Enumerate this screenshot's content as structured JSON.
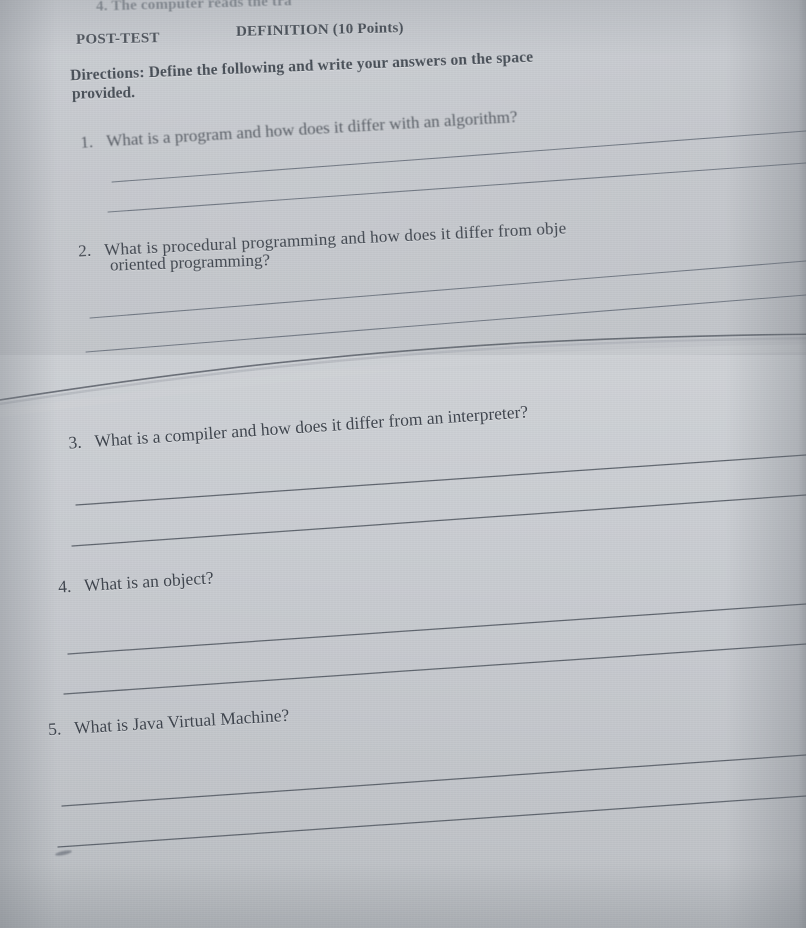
{
  "document": {
    "kind": "photographed-worksheet",
    "cut_off_top_line": "4. The computer reads the tra",
    "section_label": "POST-TEST",
    "section_type": "DEFINITION (10 Points)",
    "directions_label": "Directions:",
    "directions_line_1": "Directions: Define the following and write your answers on the space",
    "directions_line_2": "provided.",
    "questions": [
      {
        "number": "1.",
        "text": "What is a program and how does it differ with an algorithm?",
        "answer_lines": 2,
        "answer_line_values": [
          "",
          ""
        ]
      },
      {
        "number": "2.",
        "text_line_1": "What is procedural programming and how does it differ from obje",
        "text_line_2": "oriented programming?",
        "answer_lines": 2,
        "answer_line_values": [
          "",
          ""
        ]
      },
      {
        "number": "3.",
        "text": "What is a compiler and how does it differ from an interpreter?",
        "answer_lines": 2,
        "answer_line_values": [
          "",
          ""
        ]
      },
      {
        "number": "4.",
        "text": "What is an object?",
        "answer_lines": 2,
        "answer_line_values": [
          "",
          ""
        ]
      },
      {
        "number": "5.",
        "text": "What is Java Virtual Machine?",
        "answer_lines": 2,
        "answer_line_values": [
          "",
          ""
        ]
      }
    ]
  },
  "appearance": {
    "paper_color": "#c6c9ce",
    "ink_color": "#3b414a",
    "rule_line_color": "#5e646d",
    "shadow_color": "#787d84"
  }
}
